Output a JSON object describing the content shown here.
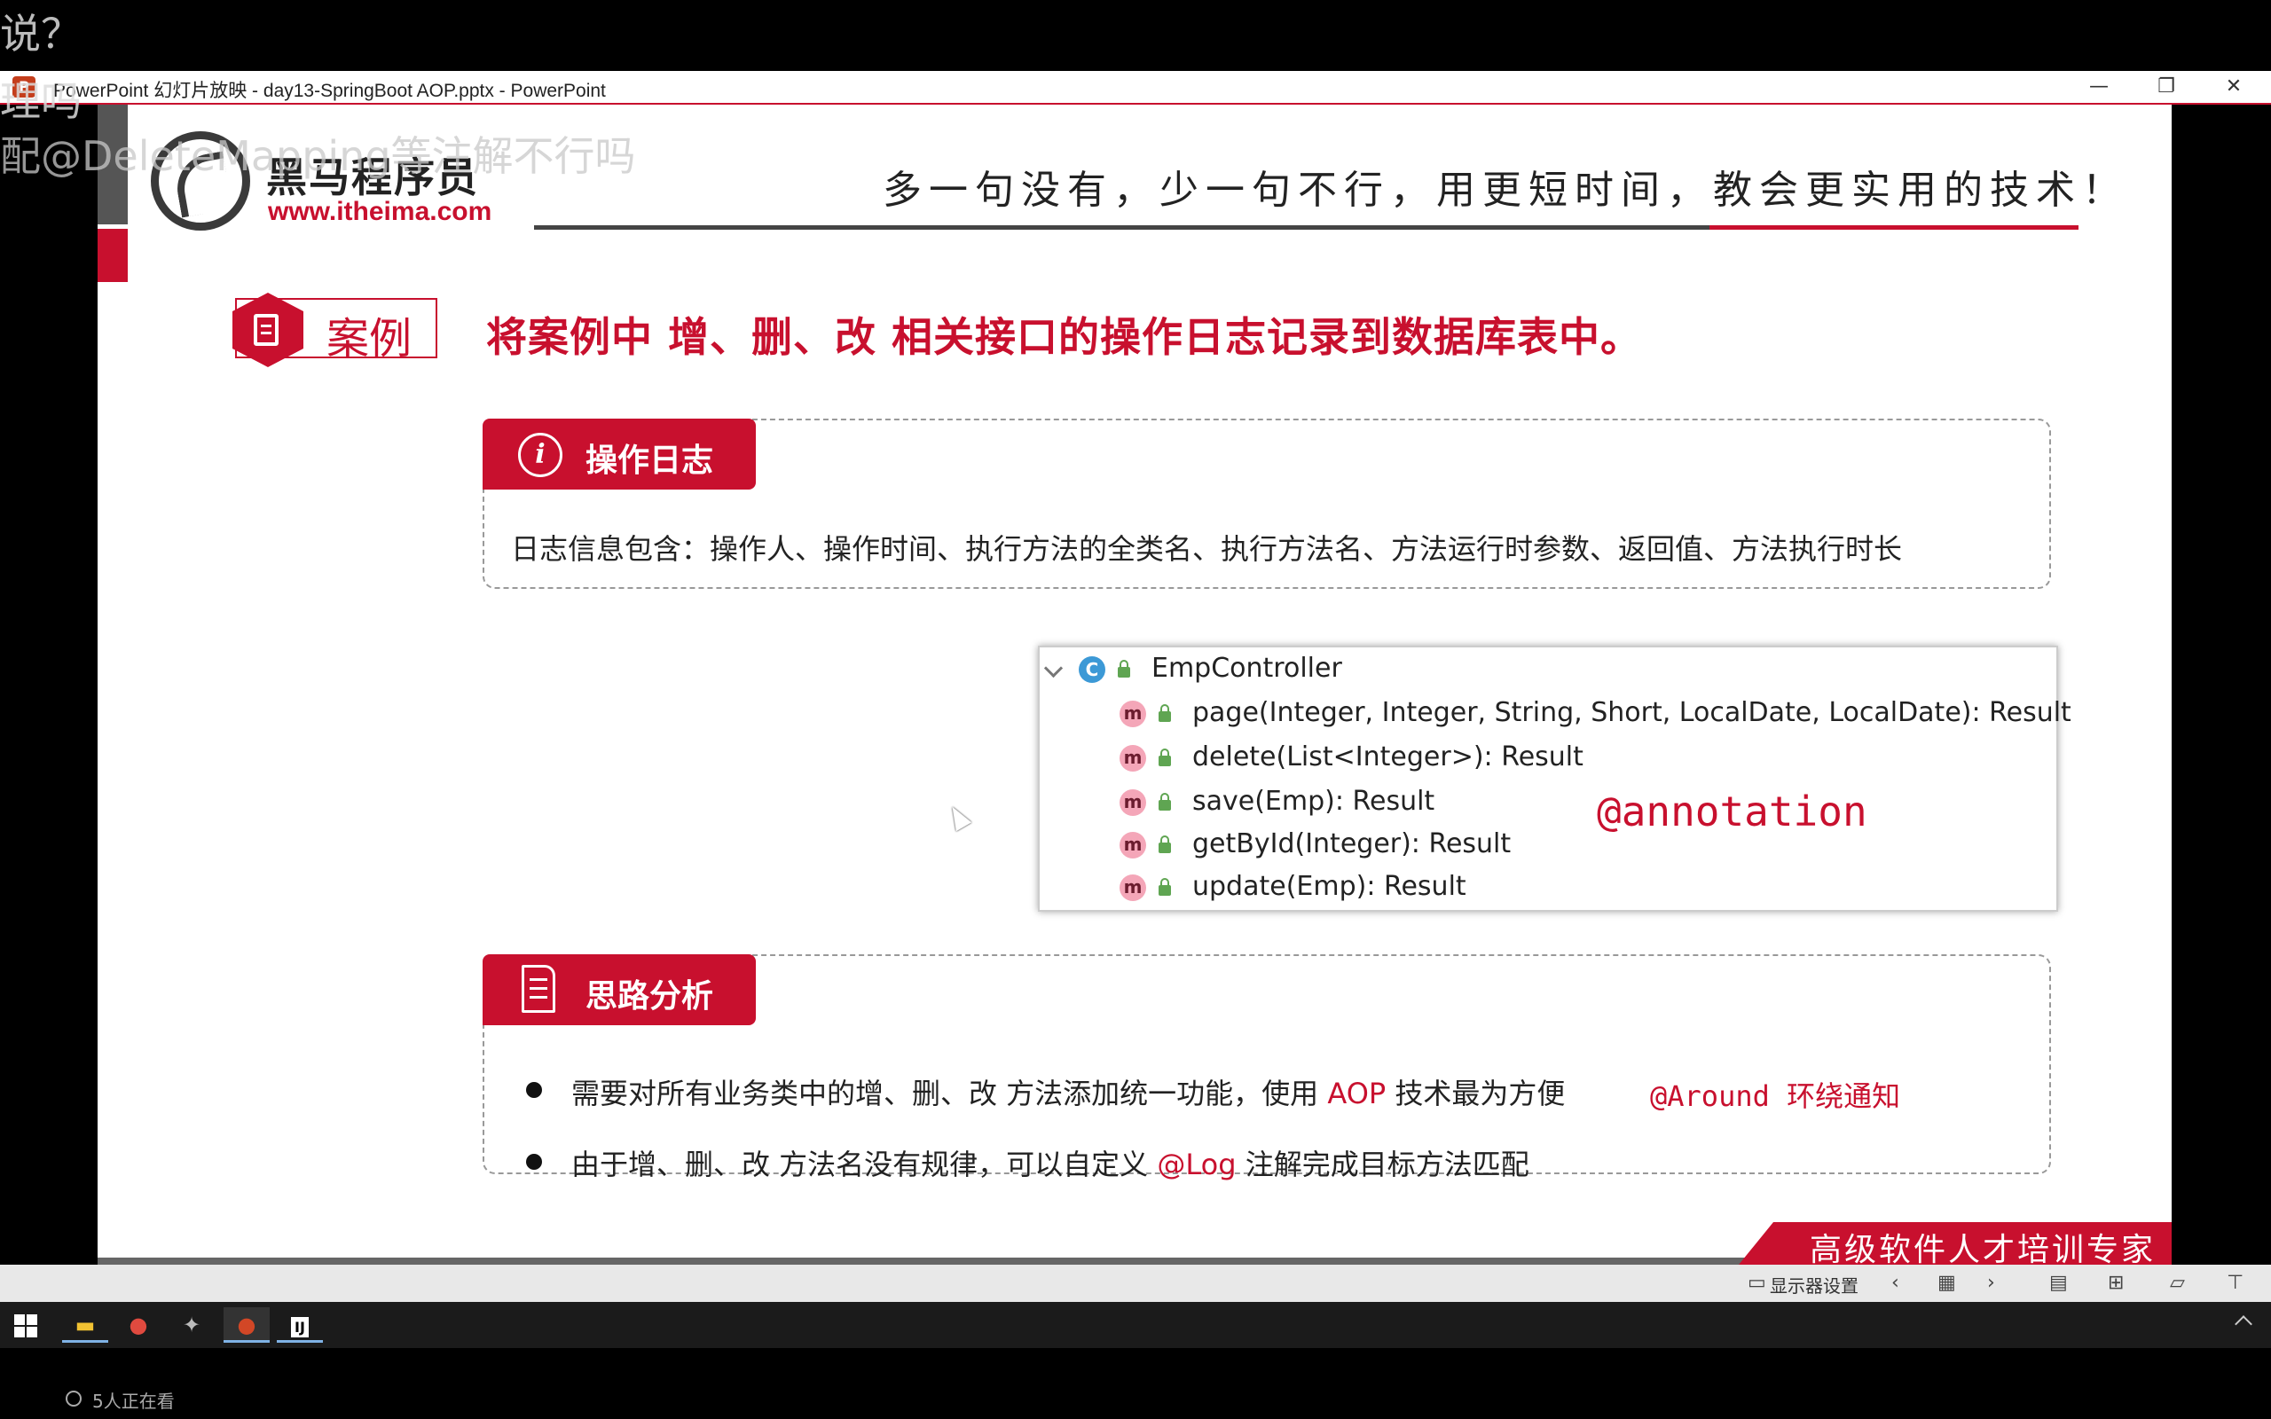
{
  "overlay": {
    "line1": "说？",
    "line2": "理吗",
    "line3": "配@DeleteMapping等注解不行吗"
  },
  "window": {
    "app_icon": "P",
    "title": "PowerPoint 幻灯片放映  -  day13-SpringBoot AOP.pptx - PowerPoint",
    "minimize": "—",
    "restore": "❐",
    "close": "✕"
  },
  "slide": {
    "logo_cn": "黑马程序员",
    "logo_url": "www.itheima.com",
    "slogan": "多一句没有，少一句不行，用更短时间，教会更实用的技术！",
    "case_label": "案例",
    "case_desc": "将案例中 增、删、改 相关接口的操作日志记录到数据库表中。",
    "log_box": {
      "icon_letter": "i",
      "header": "操作日志",
      "text": "日志信息包含：操作人、操作时间、执行方法的全类名、执行方法名、方法运行时参数、返回值、方法执行时长"
    },
    "code_tree": {
      "class_badge": "C",
      "class_name": "EmpController",
      "method_badge": "m",
      "methods": [
        "page(Integer, Integer, String, Short, LocalDate, LocalDate): Result",
        "delete(List<Integer>): Result",
        "save(Emp): Result",
        "getById(Integer): Result",
        "update(Emp): Result"
      ]
    },
    "annotation_note": "@annotation",
    "analysis_box": {
      "header": "思路分析",
      "bullet1_pre": "需要对所有业务类中的增、删、改 方法添加统一功能，使用 ",
      "bullet1_hl": "AOP",
      "bullet1_post": " 技术最为方便",
      "bullet1_note": "@Around 环绕通知",
      "bullet2_pre": "由于增、删、改 方法名没有规律，可以自定义 ",
      "bullet2_hl": "@Log",
      "bullet2_post": " 注解完成目标方法匹配"
    },
    "footer": "高级软件人才培训专家"
  },
  "slideshow_bar": {
    "display_settings": "显示器设置"
  },
  "taskbar": {
    "viewer_count": "5人正在看"
  },
  "colors": {
    "accent_red": "#c8102e",
    "badge_class": "#3c99d6",
    "badge_method": "#f4a6b8",
    "lock_green": "#5fa552"
  }
}
